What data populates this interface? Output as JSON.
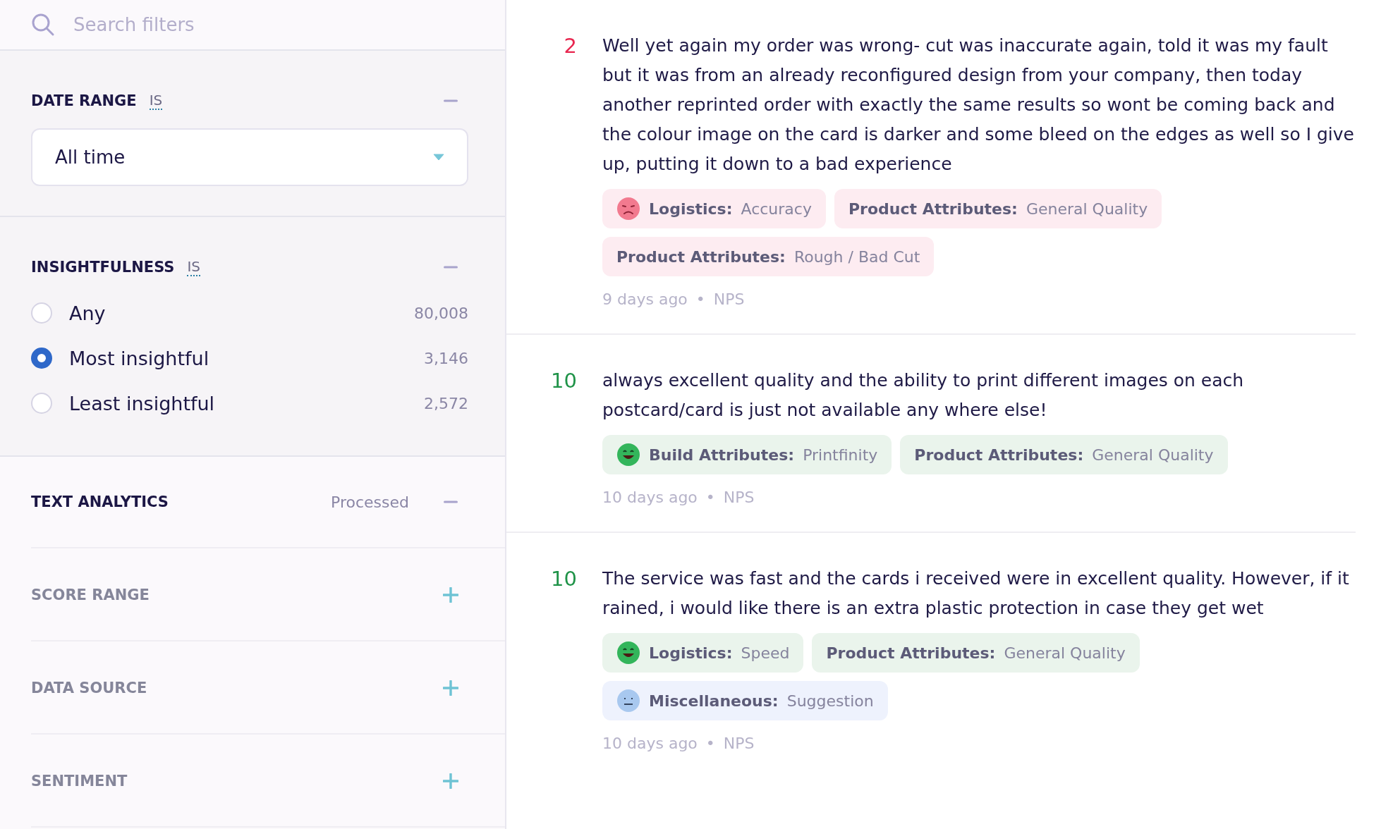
{
  "search": {
    "placeholder": "Search filters"
  },
  "filters": [
    {
      "kind": "select",
      "title": "DATE RANGE",
      "operator": "IS",
      "expanded": true,
      "value": "All time"
    },
    {
      "kind": "radio",
      "title": "INSIGHTFULNESS",
      "operator": "IS",
      "expanded": true,
      "options": [
        {
          "label": "Any",
          "count": "80,008",
          "selected": false
        },
        {
          "label": "Most insightful",
          "count": "3,146",
          "selected": true
        },
        {
          "label": "Least insightful",
          "count": "2,572",
          "selected": false
        }
      ]
    },
    {
      "kind": "plain",
      "title": "TEXT ANALYTICS",
      "summary": "Processed",
      "expanded": true
    },
    {
      "kind": "plain",
      "title": "SCORE RANGE",
      "expanded": false
    },
    {
      "kind": "plain",
      "title": "DATA SOURCE",
      "expanded": false
    },
    {
      "kind": "plain",
      "title": "SENTIMENT",
      "expanded": false
    }
  ],
  "responses": [
    {
      "score": "2",
      "color": "#e8264f",
      "text": "Well yet again my order was wrong- cut was inaccurate again, told it was my fault but it was from an already reconfigured design from your company, then today another reprinted order with exactly the same results so wont be coming back and the colour image on the card is darker and some bleed on the edges as well so I give up, putting it down to a bad experience",
      "tags": [
        {
          "color": "#fdecf1",
          "kind": "sad",
          "category": "Logistics:",
          "topic": "Accuracy"
        },
        {
          "color": "#fdecf1",
          "kind": "plain",
          "category": "Product Attributes:",
          "topic": "General Quality"
        },
        {
          "color": "#fdecf1",
          "kind": "plain",
          "category": "Product Attributes:",
          "topic": "Rough / Bad Cut"
        }
      ],
      "age": "9 days ago",
      "separator": "•",
      "source": "NPS"
    },
    {
      "score": "10",
      "color": "#1f9348",
      "text": "always excellent quality and the ability to print different images on each postcard/card is just not available any where else!",
      "tags": [
        {
          "color": "#eaf4ec",
          "kind": "happy",
          "category": "Build Attributes:",
          "topic": "Printfinity"
        },
        {
          "color": "#eaf4ec",
          "kind": "plain",
          "category": "Product Attributes:",
          "topic": "General Quality"
        }
      ],
      "age": "10 days ago",
      "separator": "•",
      "source": "NPS"
    },
    {
      "score": "10",
      "color": "#1f9348",
      "text": "The service was fast and the cards i received were in excellent quality. However, if it rained, i would like there is an extra plastic protection in case they get wet",
      "tags": [
        {
          "color": "#eaf4ec",
          "kind": "happy",
          "category": "Logistics:",
          "topic": "Speed"
        },
        {
          "color": "#eaf4ec",
          "kind": "plain",
          "category": "Product Attributes:",
          "topic": "General Quality"
        },
        {
          "color": "#eef2fd",
          "kind": "neutral",
          "category": "Miscellaneous:",
          "topic": "Suggestion"
        }
      ],
      "age": "10 days ago",
      "separator": "•",
      "source": "NPS"
    }
  ]
}
